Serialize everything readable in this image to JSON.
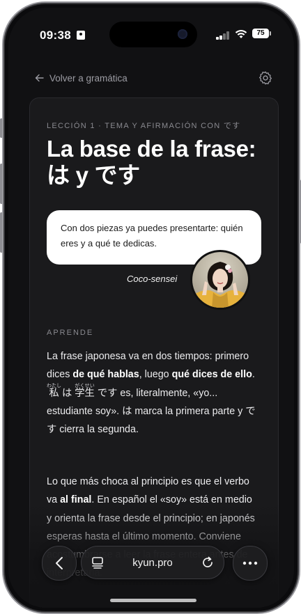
{
  "status_bar": {
    "time": "09:38",
    "battery": "75"
  },
  "nav": {
    "back_label": "Volver a gramática"
  },
  "lesson": {
    "kicker": "LECCIÓN 1 · TEMA Y AFIRMACIÓN CON です",
    "title_line1": "La base de la frase:",
    "title_line2": "は y です"
  },
  "bubble": {
    "text": "Con dos piezas ya puedes presentarte: quién eres y a qué te dedicas.",
    "speaker": "Coco-sensei"
  },
  "section_label": "APRENDE",
  "paragraph1": {
    "t1": "La frase japonesa va en dos tiempos: primero dices ",
    "b1": "de qué hablas",
    "t2": ", luego ",
    "b2": "qué dices de ello",
    "t3": ". ",
    "k1": "私",
    "r1": "わたし",
    "t4": " は ",
    "k2": "学生",
    "r2": "がくせい",
    "t5": " です es, literalmente, «yo... estudiante soy». は marca la primera parte y です cierra la segunda."
  },
  "paragraph2": {
    "t1": "Lo que más choca al principio es que el verbo va ",
    "b1": "al final",
    "t2": ". En español el «soy» está en medio y orienta la frase desde el principio; en japonés esperas hasta el último momento. Conviene acostumbrarse a leer la frase entera antes de interpretarla."
  },
  "browser": {
    "url": "kyun.pro"
  },
  "colors": {
    "background": "#111113",
    "card": "#1a1a1c",
    "bubble": "#ffffff",
    "muted_text": "#8a8a90"
  },
  "icons": [
    "arrow-left-icon",
    "gear-icon",
    "chevron-left-icon",
    "tabs-icon",
    "reload-icon",
    "more-icon"
  ]
}
